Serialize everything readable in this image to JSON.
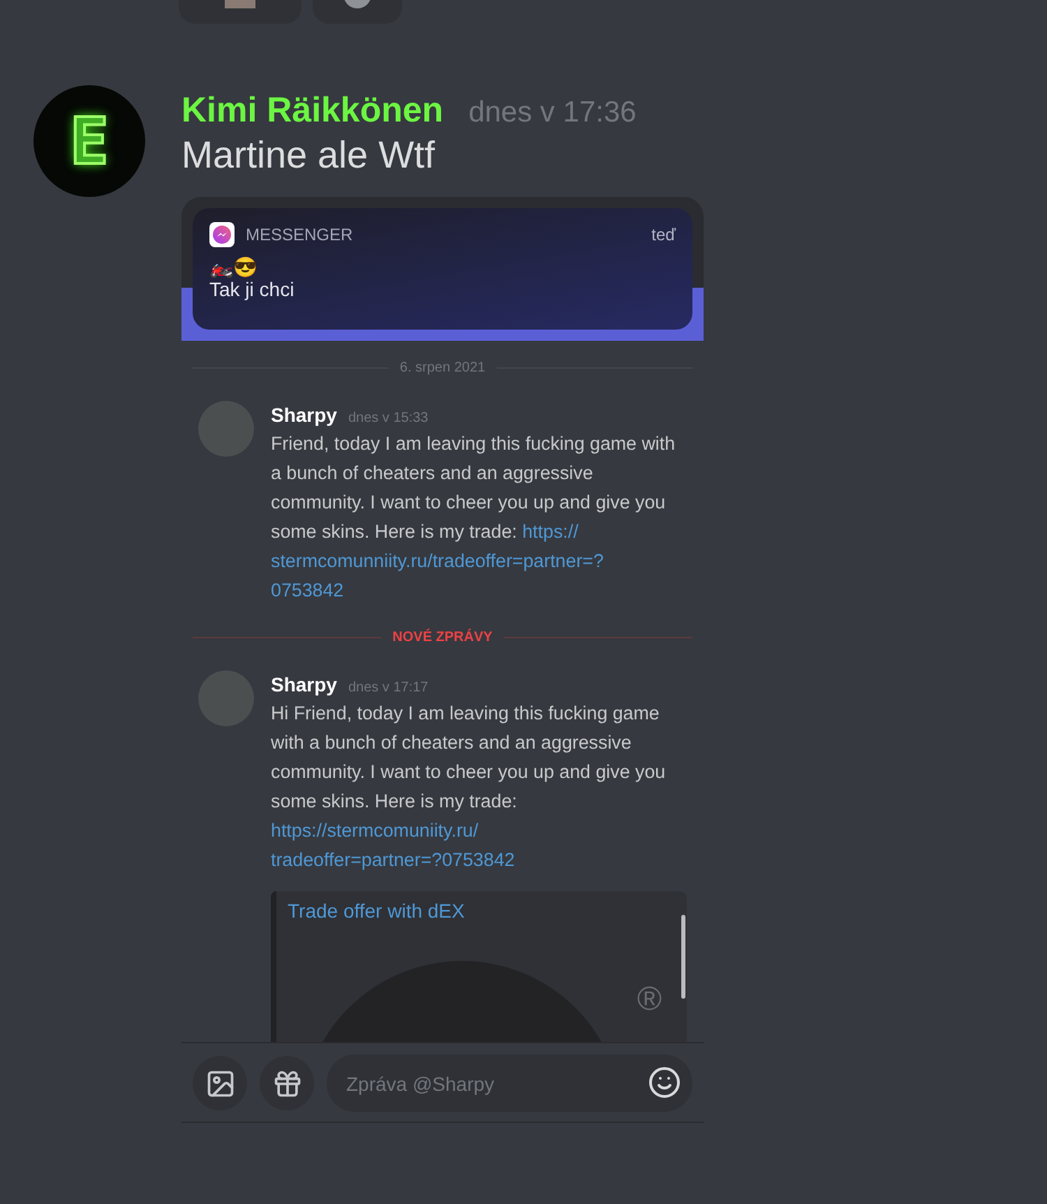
{
  "message": {
    "avatar_letter": "E",
    "author": "Kimi Räikkönen",
    "time": "dnes v 17:36",
    "text": "Martine ale Wtf"
  },
  "screenshot": {
    "notification": {
      "app": "MESSENGER",
      "time": "teď",
      "emoji": "🏍️😎",
      "text": "Tak ji chci"
    },
    "date_divider": "6. srpen 2021",
    "messages": [
      {
        "author": "Sharpy",
        "time": "dnes v 15:33",
        "body": "Friend, today I am leaving this fucking game with a bunch of cheaters and an aggressive community. I want to cheer you up and give you some skins. Here is my trade:",
        "link_lines": [
          "https://",
          "stermcomunniity.ru/tradeoffer=partner=?",
          "0753842"
        ]
      },
      {
        "author": "Sharpy",
        "time": "dnes v 17:17",
        "body": "Hi Friend, today I am leaving this fucking game with a bunch of cheaters and an aggressive community. I want to cheer you up and give you some skins. Here is my trade:",
        "link_lines": [
          "https://stermcomuniity.ru/",
          "tradeoffer=partner=?0753842"
        ]
      }
    ],
    "new_divider": "NOVÉ ZPRÁVY",
    "embed": {
      "title": "Trade offer with dEX",
      "mark": "®"
    },
    "input": {
      "placeholder": "Zpráva @Sharpy"
    }
  }
}
